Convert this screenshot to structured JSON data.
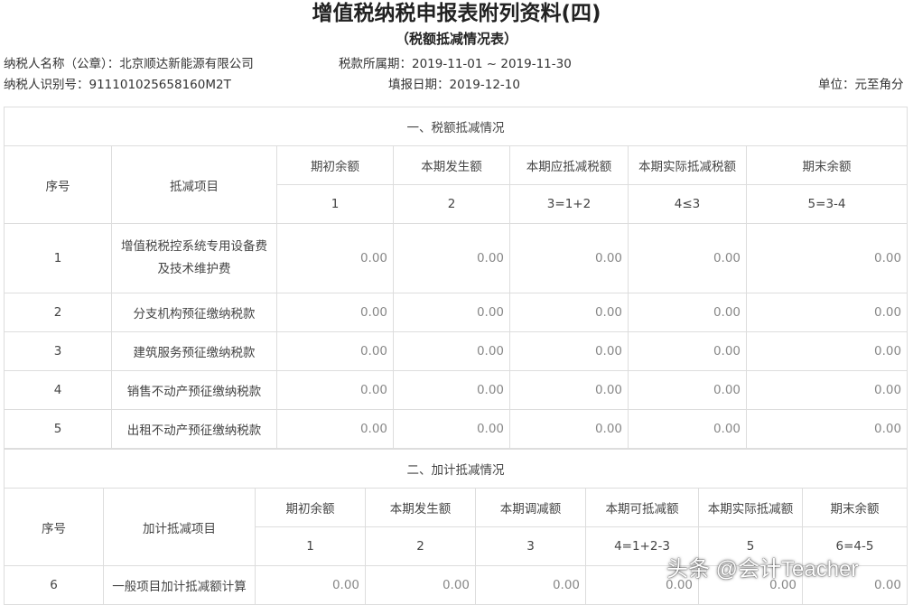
{
  "header": {
    "title": "增值税纳税申报表附列资料(四)",
    "subtitle": "（税额抵减情况表）",
    "taxpayer_name": "纳税人名称（公章）：北京顺达新能源有限公司",
    "period": "税款所属期：2019-11-01 ~ 2019-11-30",
    "taxpayer_id": "纳税人识别号：911101025658160M2T",
    "fill_date": "填报日期：2019-12-10",
    "unit": "单位：元至角分"
  },
  "section1": {
    "title": "一、税额抵减情况",
    "col_seq": "序号",
    "col_item": "抵减项目",
    "headers": [
      "期初余额",
      "本期发生额",
      "本期应抵减税额",
      "本期实际抵减税额",
      "期末余额"
    ],
    "codes": [
      "1",
      "2",
      "3=1+2",
      "4≤3",
      "5=3-4"
    ],
    "rows": [
      {
        "seq": "1",
        "item_line1": "增值税税控系统专用设备费",
        "item_line2": "及技术维护费",
        "values": [
          "0.00",
          "0.00",
          "0.00",
          "0.00",
          "0.00"
        ]
      },
      {
        "seq": "2",
        "item": "分支机构预征缴纳税款",
        "values": [
          "0.00",
          "0.00",
          "0.00",
          "0.00",
          "0.00"
        ]
      },
      {
        "seq": "3",
        "item": "建筑服务预征缴纳税款",
        "values": [
          "0.00",
          "0.00",
          "0.00",
          "0.00",
          "0.00"
        ]
      },
      {
        "seq": "4",
        "item": "销售不动产预征缴纳税款",
        "values": [
          "0.00",
          "0.00",
          "0.00",
          "0.00",
          "0.00"
        ]
      },
      {
        "seq": "5",
        "item": "出租不动产预征缴纳税款",
        "values": [
          "0.00",
          "0.00",
          "0.00",
          "0.00",
          "0.00"
        ]
      }
    ]
  },
  "section2": {
    "title": "二、加计抵减情况",
    "col_seq": "序号",
    "col_item": "加计抵减项目",
    "headers": [
      "期初余额",
      "本期发生额",
      "本期调减额",
      "本期可抵减额",
      "本期实际抵减额",
      "期末余额"
    ],
    "codes": [
      "1",
      "2",
      "3",
      "4=1+2-3",
      "5",
      "6=4-5"
    ],
    "rows": [
      {
        "seq": "6",
        "item": "一般项目加计抵减额计算",
        "values": [
          "0.00",
          "0.00",
          "0.00",
          "0.00",
          "0.00",
          "0.00"
        ]
      }
    ]
  },
  "watermark": "头条 @会计Teacher"
}
